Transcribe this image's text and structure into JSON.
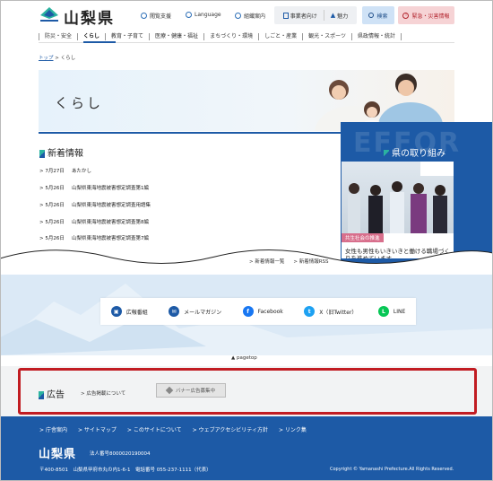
{
  "header": {
    "logo_text": "山梨県",
    "links": [
      {
        "label": "閲覧支援",
        "icon": "accessibility-icon"
      },
      {
        "label": "Language",
        "icon": "globe-icon"
      },
      {
        "label": "組織案内",
        "icon": "organization-icon"
      }
    ],
    "business_label": "事業者向け",
    "attraction_label": "魅力",
    "search_label": "検索",
    "emergency_label": "緊急・災害情報"
  },
  "global_nav": [
    "防災・安全",
    "くらし",
    "教育・子育て",
    "医療・健康・福祉",
    "まちづくり・環境",
    "しごと・産業",
    "観光・スポーツ",
    "県政情報・統計"
  ],
  "breadcrumb": {
    "home": "トップ",
    "sep": " > ",
    "current": "くらし"
  },
  "hero": {
    "title": "くらし"
  },
  "news": {
    "title": "新着情報",
    "items": [
      {
        "date": "7月27日",
        "text": "あたかし"
      },
      {
        "date": "5月26日",
        "text": "山梨県東海地震被害想定調査第1編"
      },
      {
        "date": "5月26日",
        "text": "山梨県東海地震被害想定調査用語集"
      },
      {
        "date": "5月26日",
        "text": "山梨県東海地震被害想定調査第8編"
      },
      {
        "date": "5月26日",
        "text": "山梨県東海地震被害想定調査第7編"
      }
    ],
    "more_label": "新着情報一覧",
    "rss_label": "新着情報RSS"
  },
  "pref": {
    "bg_text": "EFFOR",
    "title": "県の取り組み",
    "tag": "共生社会の推進",
    "text": "女性も男性もいきいきと働ける職場づくりを進めています"
  },
  "social": [
    {
      "label": "広報番組",
      "icon": "tv-icon",
      "color": "#1d5aa6",
      "glyph": "▣"
    },
    {
      "label": "メールマガジン",
      "icon": "mail-icon",
      "color": "#1d5aa6",
      "glyph": "✉"
    },
    {
      "label": "Facebook",
      "icon": "facebook-icon",
      "color": "#1877f2",
      "glyph": "f"
    },
    {
      "label": "X（旧Twitter）",
      "icon": "twitter-icon",
      "color": "#1da1f2",
      "glyph": "t"
    },
    {
      "label": "LINE",
      "icon": "line-icon",
      "color": "#06c755",
      "glyph": "L"
    }
  ],
  "pagetop_label": "pagetop",
  "ad": {
    "title": "広告",
    "link": "広告掲載について",
    "banner": "バナー広告募集中"
  },
  "footer": {
    "links": [
      "庁舎案内",
      "サイトマップ",
      "このサイトについて",
      "ウェブアクセシビリティ方針",
      "リンク集"
    ],
    "name": "山梨県",
    "corp_number": "法人番号8000020190004",
    "address": "〒400-8501　山梨県甲府市丸の内1-6-1　電話番号 055-237-1111（代表）",
    "copyright": "Copyright © Yamanashi Prefecture.All Rights Reserved."
  },
  "colors": {
    "brand_blue": "#1d5aa6",
    "emergency_red": "#b3262f",
    "highlight_border": "#c11c22"
  }
}
